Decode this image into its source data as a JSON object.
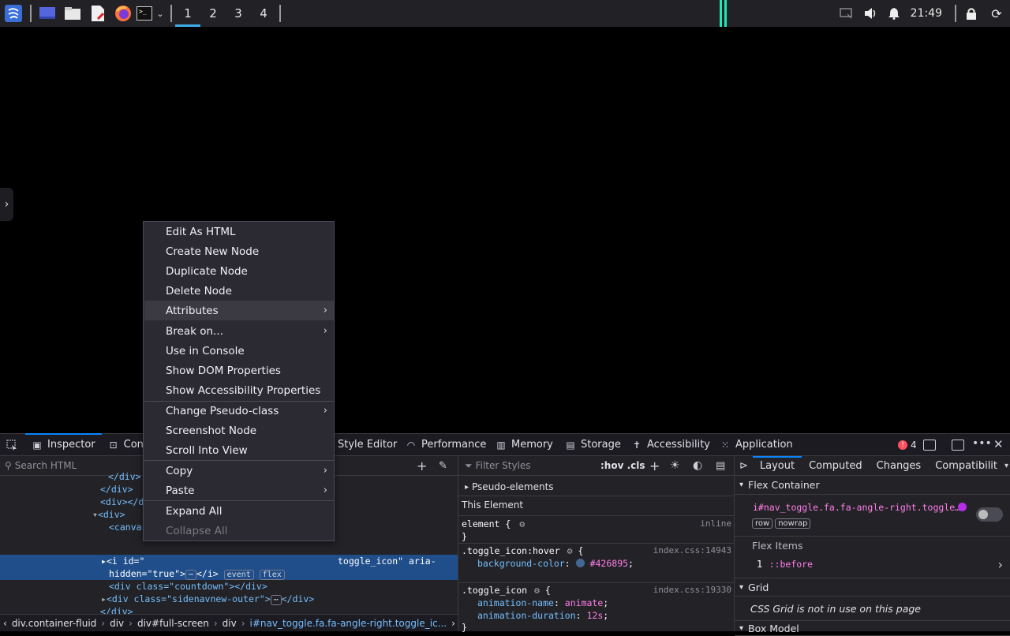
{
  "taskbar": {
    "workspaces": [
      "1",
      "2",
      "3",
      "4"
    ],
    "clock": "21:49"
  },
  "devtools": {
    "tabs": [
      "Inspector",
      "Con",
      "Style Editor",
      "Performance",
      "Memory",
      "Storage",
      "Accessibility",
      "Application"
    ],
    "error_count": "4",
    "html_search_placeholder": "Search HTML",
    "html_lines": {
      "l1": "</div>",
      "l2": "<div></div>",
      "l3": "<div></d",
      "l4": "<div>",
      "l5": "<canvas",
      "sel_a": "<i id=\"",
      "sel_b": "toggle_icon\" aria-",
      "sel_c": "hidden=\"true\">",
      "sel_d": "</i>",
      "badge_event": "event",
      "badge_flex": "flex",
      "l7": "<div class=\"countdown\"></div>",
      "l8_a": "<div class=\"sidenavnew-outer\">",
      "l8_b": "</div>",
      "l9": "</div>",
      "l10": "</div>"
    },
    "breadcrumbs": [
      "div.container-fluid",
      "div",
      "div#full-screen",
      "div",
      "i#nav_toggle.fa.fa-angle-right.toggle_ic..."
    ],
    "rules": {
      "filter_placeholder": "Filter Styles",
      "hov_cls": ":hov .cls",
      "pseudo_elements": "Pseudo-elements",
      "this_element": "This Element",
      "element_rule": "element {",
      "inline": "inline",
      "close": "}",
      "rule1_selector": ".toggle_icon:hover",
      "rule1_src": "index.css:14943",
      "rule1_prop": "background-color",
      "rule1_val": "#426895",
      "rule2_selector": ".toggle_icon",
      "rule2_src": "index.css:19330",
      "rule2_prop1": "animation-name",
      "rule2_val1": "animate",
      "rule2_prop2": "animation-duration",
      "rule2_val2": "12s"
    },
    "layout": {
      "tabs": [
        "Layout",
        "Computed",
        "Changes",
        "Compatibilit"
      ],
      "flex_container": "Flex Container",
      "flex_selector": "i#nav_toggle.fa.fa-angle-right.toggle…",
      "badge_row": "row",
      "badge_nowrap": "nowrap",
      "flex_items": "Flex Items",
      "flex_item_num": "1",
      "flex_item_name": "::before",
      "grid": "Grid",
      "grid_msg": "CSS Grid is not in use on this page",
      "box_model": "Box Model"
    }
  },
  "context_menu": {
    "items": [
      "Edit As HTML",
      "Create New Node",
      "Duplicate Node",
      "Delete Node",
      "Attributes",
      "Break on...",
      "Use in Console",
      "Show DOM Properties",
      "Show Accessibility Properties",
      "Change Pseudo-class",
      "Screenshot Node",
      "Scroll Into View",
      "Copy",
      "Paste",
      "Expand All",
      "Collapse All"
    ]
  },
  "colors": {
    "accent": "#0a84ff",
    "selection": "#204e8a",
    "swatch": "#426895"
  }
}
